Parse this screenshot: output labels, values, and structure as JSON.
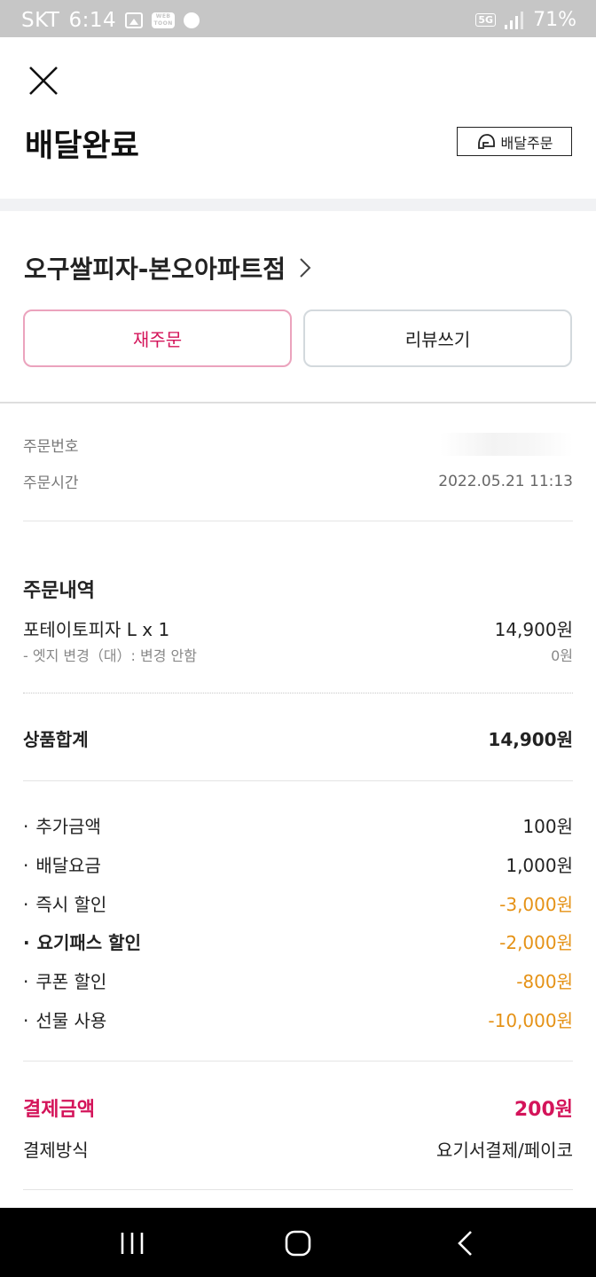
{
  "status_bar": {
    "carrier": "SKT",
    "time": "6:14",
    "network": "5G",
    "battery": "71%"
  },
  "header": {
    "title": "배달완료",
    "badge_label": "배달주문"
  },
  "store": {
    "name": "오구쌀피자-본오아파트점"
  },
  "actions": {
    "reorder_label": "재주문",
    "review_label": "리뷰쓰기"
  },
  "order_info": {
    "number_label": "주문번호",
    "time_label": "주문시간",
    "time_value": "2022.05.21 11:13"
  },
  "order_details": {
    "heading": "주문내역",
    "items": [
      {
        "name": "포테이토피자 L x 1",
        "price": "14,900원",
        "option_name": "- 엣지 변경（대）: 변경 안함",
        "option_price": "0원"
      }
    ],
    "subtotal_label": "상품합계",
    "subtotal_value": "14,900원"
  },
  "fees": [
    {
      "label": "추가금액",
      "value": "100원"
    },
    {
      "label": "배달요금",
      "value": "1,000원"
    },
    {
      "label": "즉시 할인",
      "value": "-3,000원"
    },
    {
      "label": "요기패스 할인",
      "value": "-2,000원"
    },
    {
      "label": "쿠폰 할인",
      "value": "-800원"
    },
    {
      "label": "선물 사용",
      "value": "-10,000원"
    }
  ],
  "payment": {
    "total_label": "결제금액",
    "total_value": "200원",
    "method_label": "결제방식",
    "method_value": "요기서결제/페이코"
  },
  "colors": {
    "accent": "#d4145a",
    "discount": "#e59216",
    "status_bar": "#c6c6c6"
  },
  "icons": [
    "close-icon",
    "helmet-icon",
    "chevron-right-icon",
    "recents-icon",
    "home-icon",
    "back-icon"
  ]
}
